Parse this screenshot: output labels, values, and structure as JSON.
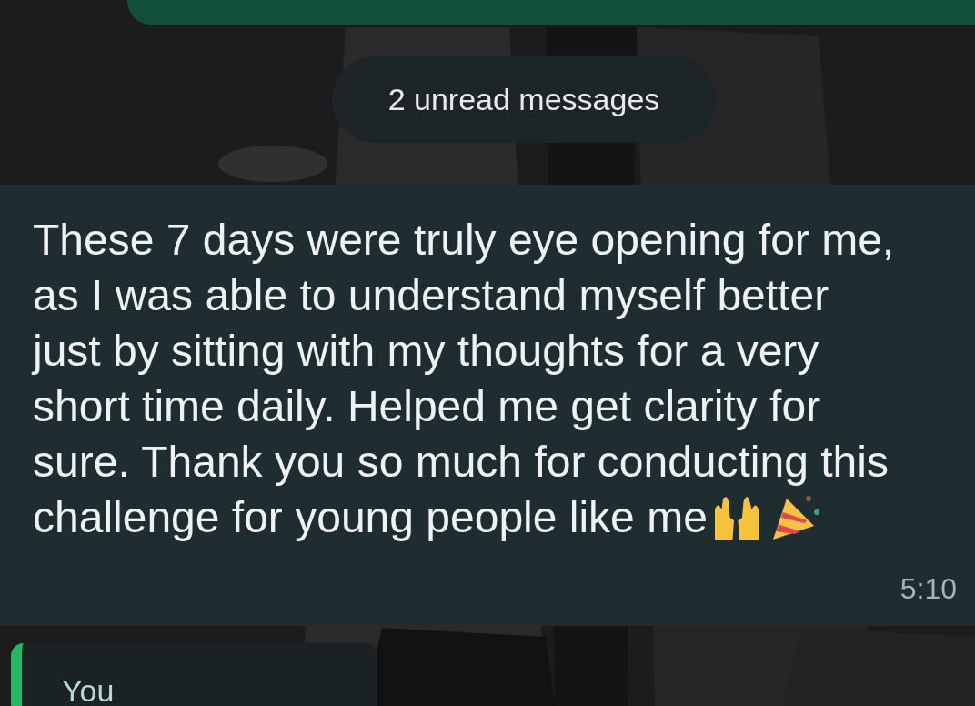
{
  "unread_banner": {
    "text": "2 unread messages"
  },
  "message": {
    "lines": [
      "These 7 days were truly eye opening for me,",
      "as I was able to understand myself better",
      "just by sitting with my thoughts for a very",
      "short time daily. Helped me get clarity for",
      "sure. Thank you so much for conducting this",
      "challenge for young people like me"
    ],
    "time": "5:10"
  },
  "reply": {
    "author": "You"
  }
}
